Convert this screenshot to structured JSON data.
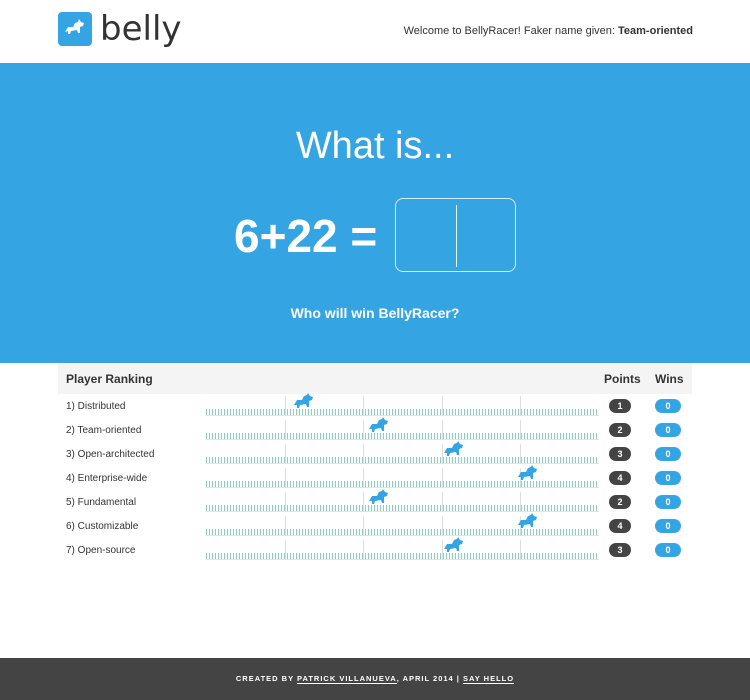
{
  "header": {
    "logo_text": "belly",
    "welcome_prefix": "Welcome to BellyRacer! Faker name given: ",
    "player_name": "Team-oriented"
  },
  "hero": {
    "title": "What is...",
    "equation": "6+22 =",
    "answer_value": "",
    "subtitle": "Who will win BellyRacer?"
  },
  "ranking": {
    "title": "Player Ranking",
    "points_label": "Points",
    "wins_label": "Wins",
    "players": [
      {
        "name": "1) Distributed",
        "points": "1",
        "wins": "0",
        "progress": 0.25
      },
      {
        "name": "2) Team-oriented",
        "points": "2",
        "wins": "0",
        "progress": 0.44
      },
      {
        "name": "3) Open-architected",
        "points": "3",
        "wins": "0",
        "progress": 0.63
      },
      {
        "name": "4) Enterprise-wide",
        "points": "4",
        "wins": "0",
        "progress": 0.82
      },
      {
        "name": "5) Fundamental",
        "points": "2",
        "wins": "0",
        "progress": 0.44
      },
      {
        "name": "6) Customizable",
        "points": "4",
        "wins": "0",
        "progress": 0.82
      },
      {
        "name": "7) Open-source",
        "points": "3",
        "wins": "0",
        "progress": 0.63
      }
    ]
  },
  "footer": {
    "prefix": "CREATED BY ",
    "author": "PATRICK VILLANUEVA",
    "date": ", APRIL 2014 | ",
    "contact": "SAY HELLO"
  },
  "colors": {
    "accent": "#34a5e2",
    "dark": "#444444",
    "grass": "#2ea889"
  }
}
